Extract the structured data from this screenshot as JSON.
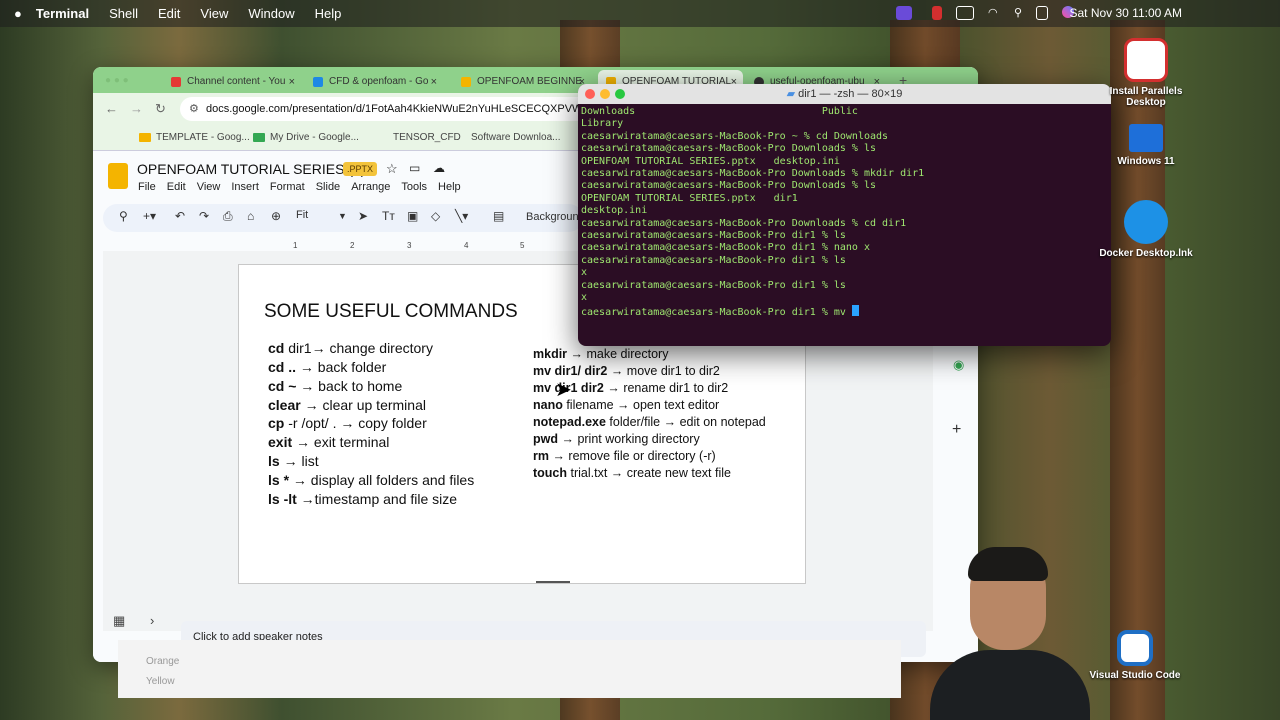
{
  "menubar": {
    "app": "Terminal",
    "items": [
      "Shell",
      "Edit",
      "View",
      "Window",
      "Help"
    ],
    "datetime": "Sat Nov 30  11:00 AM"
  },
  "browser": {
    "tabs": [
      {
        "label": "Channel content - You",
        "color": "#e53935"
      },
      {
        "label": "CFD & openfoam - Go",
        "color": "#1e88e5"
      },
      {
        "label": "OPENFOAM BEGINNE",
        "color": "#f4b400"
      },
      {
        "label": "OPENFOAM TUTORIAL",
        "color": "#f4b400"
      },
      {
        "label": "useful-openfoam-ubu",
        "color": "#333333"
      }
    ],
    "url": "docs.google.com/presentation/d/1FotAah4KkieNWuE2nYuHLeSCECQXPVWe",
    "bookmarks": [
      "TEMPLATE - Goog...",
      "My Drive - Google...",
      "TENSOR_CFD",
      "Software Downloa..."
    ]
  },
  "slides_app": {
    "doc_title": "OPENFOAM TUTORIAL SERIES (2)",
    "badge": ".PPTX",
    "menus": [
      "File",
      "Edit",
      "View",
      "Insert",
      "Format",
      "Slide",
      "Arrange",
      "Tools",
      "Help"
    ],
    "zoom": "Fit",
    "background_label": "Backgroun",
    "ruler": [
      "1",
      "2",
      "3",
      "4",
      "5"
    ],
    "notes_placeholder": "Click to add speaker notes"
  },
  "slide": {
    "title": "SOME USEFUL COMMANDS",
    "left_commands": [
      {
        "cmd": "cd",
        "desc": " dir1→ change directory"
      },
      {
        "cmd": "cd ..",
        "desc": " → back folder"
      },
      {
        "cmd": "cd ~",
        "desc": " → back to home"
      },
      {
        "cmd": "clear",
        "desc": " → clear up terminal"
      },
      {
        "cmd": "cp",
        "desc": " -r /opt/ . → copy folder"
      },
      {
        "cmd": "exit",
        "desc": " → exit terminal"
      },
      {
        "cmd": "ls",
        "desc": " → list"
      },
      {
        "cmd": "ls *",
        "desc": " → display all folders and files"
      },
      {
        "cmd": "ls -lt",
        "desc": " →timestamp and file size"
      }
    ],
    "right_commands": [
      {
        "cmd": "mkdir",
        "desc": " → make directory"
      },
      {
        "cmd": "mv dir1/ dir2",
        "desc": " → move dir1 to dir2"
      },
      {
        "cmd": "mv dir1 dir2",
        "desc": " → rename dir1 to dir2"
      },
      {
        "cmd": "nano",
        "desc": " filename → open text editor"
      },
      {
        "cmd": "notepad.exe",
        "desc": " folder/file → edit on notepad"
      },
      {
        "cmd": "pwd",
        "desc": " → print working directory"
      },
      {
        "cmd": "rm",
        "desc": " → remove file or directory (-r)"
      },
      {
        "cmd": "touch",
        "desc": " trial.txt → create new text file"
      }
    ]
  },
  "terminal": {
    "title": "dir1 — -zsh — 80×19",
    "lines": [
      "Downloads                               Public",
      "Library",
      "caesarwiratama@caesars-MacBook-Pro ~ % cd Downloads",
      "caesarwiratama@caesars-MacBook-Pro Downloads % ls",
      "OPENFOAM TUTORIAL SERIES.pptx   desktop.ini",
      "caesarwiratama@caesars-MacBook-Pro Downloads % mkdir dir1",
      "caesarwiratama@caesars-MacBook-Pro Downloads % ls",
      "OPENFOAM TUTORIAL SERIES.pptx   dir1",
      "desktop.ini",
      "caesarwiratama@caesars-MacBook-Pro Downloads % cd dir1",
      "caesarwiratama@caesars-MacBook-Pro dir1 % ls",
      "caesarwiratama@caesars-MacBook-Pro dir1 % nano x",
      "caesarwiratama@caesars-MacBook-Pro dir1 % ls",
      "x",
      "caesarwiratama@caesars-MacBook-Pro dir1 % ls",
      "x",
      "caesarwiratama@caesars-MacBook-Pro dir1 % mv "
    ]
  },
  "desktop_icons": [
    {
      "label": "Install Parallels Desktop",
      "color": "#d32f2f"
    },
    {
      "label": "Windows 11",
      "color": "#1e6fd9"
    },
    {
      "label": "Docker Desktop.lnk",
      "color": "#1d91e6"
    },
    {
      "label": "Visual Studio Code",
      "color": "#1f6fc5"
    }
  ],
  "behind_panel": {
    "items": [
      "Orange",
      "Yellow"
    ]
  }
}
